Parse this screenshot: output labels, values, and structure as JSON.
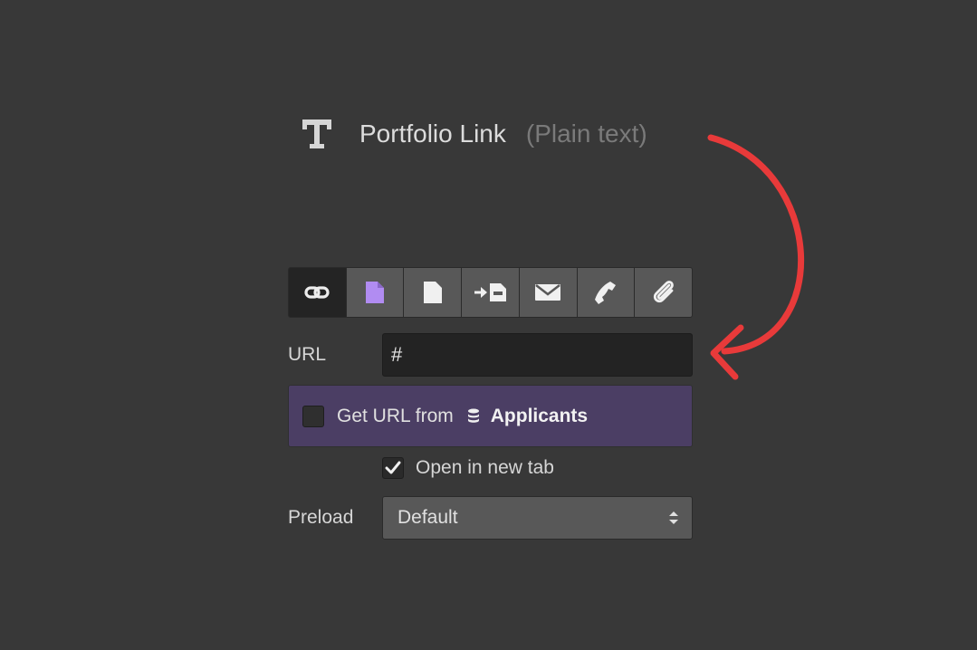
{
  "field": {
    "icon": "text-type-icon",
    "name": "Portfolio Link",
    "type": "(Plain text)"
  },
  "link_types": [
    {
      "icon": "link-icon",
      "active": true
    },
    {
      "icon": "page-icon",
      "color": "#b18cf2"
    },
    {
      "icon": "file-icon"
    },
    {
      "icon": "section-jump-icon"
    },
    {
      "icon": "email-icon"
    },
    {
      "icon": "phone-icon"
    },
    {
      "icon": "attachment-icon"
    }
  ],
  "url": {
    "label": "URL",
    "value": "#"
  },
  "binding": {
    "text": "Get URL from",
    "icon": "database-icon",
    "source": "Applicants",
    "checked": false
  },
  "new_tab": {
    "label": "Open in new tab",
    "checked": true
  },
  "preload": {
    "label": "Preload",
    "value": "Default"
  },
  "colors": {
    "background": "#383838",
    "binding_bg": "#4b3e64",
    "arrow": "#e83a3a",
    "accent": "#b18cf2"
  }
}
